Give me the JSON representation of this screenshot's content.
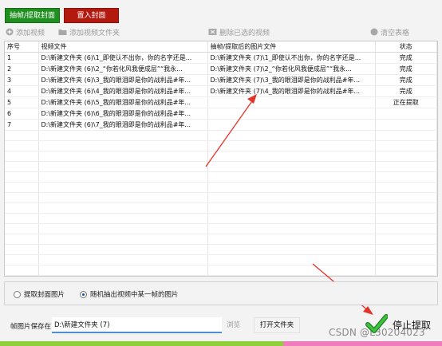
{
  "tabs": {
    "extract_cover": {
      "label": "抽帧/提取封面",
      "color": "#1f8f1f"
    },
    "insert_cover": {
      "label": "置入封面",
      "color": "#b3190f"
    }
  },
  "toolbar": {
    "add_video": "添加视频",
    "add_video_folder": "添加视频文件夹",
    "delete_selected": "删除已选的视频",
    "clear_table": "清空表格"
  },
  "table": {
    "columns": [
      "序号",
      "视频文件",
      "抽帧/提取后的图片文件",
      "状态"
    ],
    "rows": [
      {
        "index": "1",
        "video": "D:\\新建文件夹 (6)\\1_即使认不出你，你的名字还是...",
        "image": "D:\\新建文件夹 (7)\\1_即使认不出你，你的名字还是...",
        "status": "完成"
      },
      {
        "index": "2",
        "video": "D:\\新建文件夹 (6)\\2_“你若化风我便成层”“我永...",
        "image": "D:\\新建文件夹 (7)\\2_“你若化风我便成层”“我永...",
        "status": "完成"
      },
      {
        "index": "3",
        "video": "D:\\新建文件夹 (6)\\3_我的眼泪即是你的战利品#年...",
        "image": "D:\\新建文件夹 (7)\\3_我的眼泪即是你的战利品#年...",
        "status": "完成"
      },
      {
        "index": "4",
        "video": "D:\\新建文件夹 (6)\\4_我的眼泪即是你的战利品#年...",
        "image": "D:\\新建文件夹 (7)\\4_我的眼泪即是你的战利品#年...",
        "status": "完成"
      },
      {
        "index": "5",
        "video": "D:\\新建文件夹 (6)\\5_我的眼泪即是你的战利品#年...",
        "image": "",
        "status": "正在提取"
      },
      {
        "index": "6",
        "video": "D:\\新建文件夹 (6)\\6_我的眼泪即是你的战利品#年...",
        "image": "",
        "status": ""
      },
      {
        "index": "7",
        "video": "D:\\新建文件夹 (6)\\7_我的眼泪即是你的战利品#年...",
        "image": "",
        "status": ""
      }
    ]
  },
  "options": {
    "extract_cover_image": {
      "label": "提取封面图片",
      "selected": false
    },
    "random_frame": {
      "label": "随机抽出视频中某一帧的图片",
      "selected": true
    }
  },
  "save": {
    "label": "帧图片保存在:",
    "value": "D:\\新建文件夹 (7)",
    "browse_label": "浏览",
    "open_folder_label": "打开文件夹"
  },
  "stop_button": {
    "label": "停止提取",
    "icon": "check-icon",
    "color": "#29a629"
  },
  "watermark": "CSDN @L30204023",
  "progress": {
    "fraction": 0.64,
    "color": "#8fcf3a",
    "remainder_color": "#f07bbd"
  },
  "colors": {
    "annotation_arrow": "#e6332a"
  }
}
